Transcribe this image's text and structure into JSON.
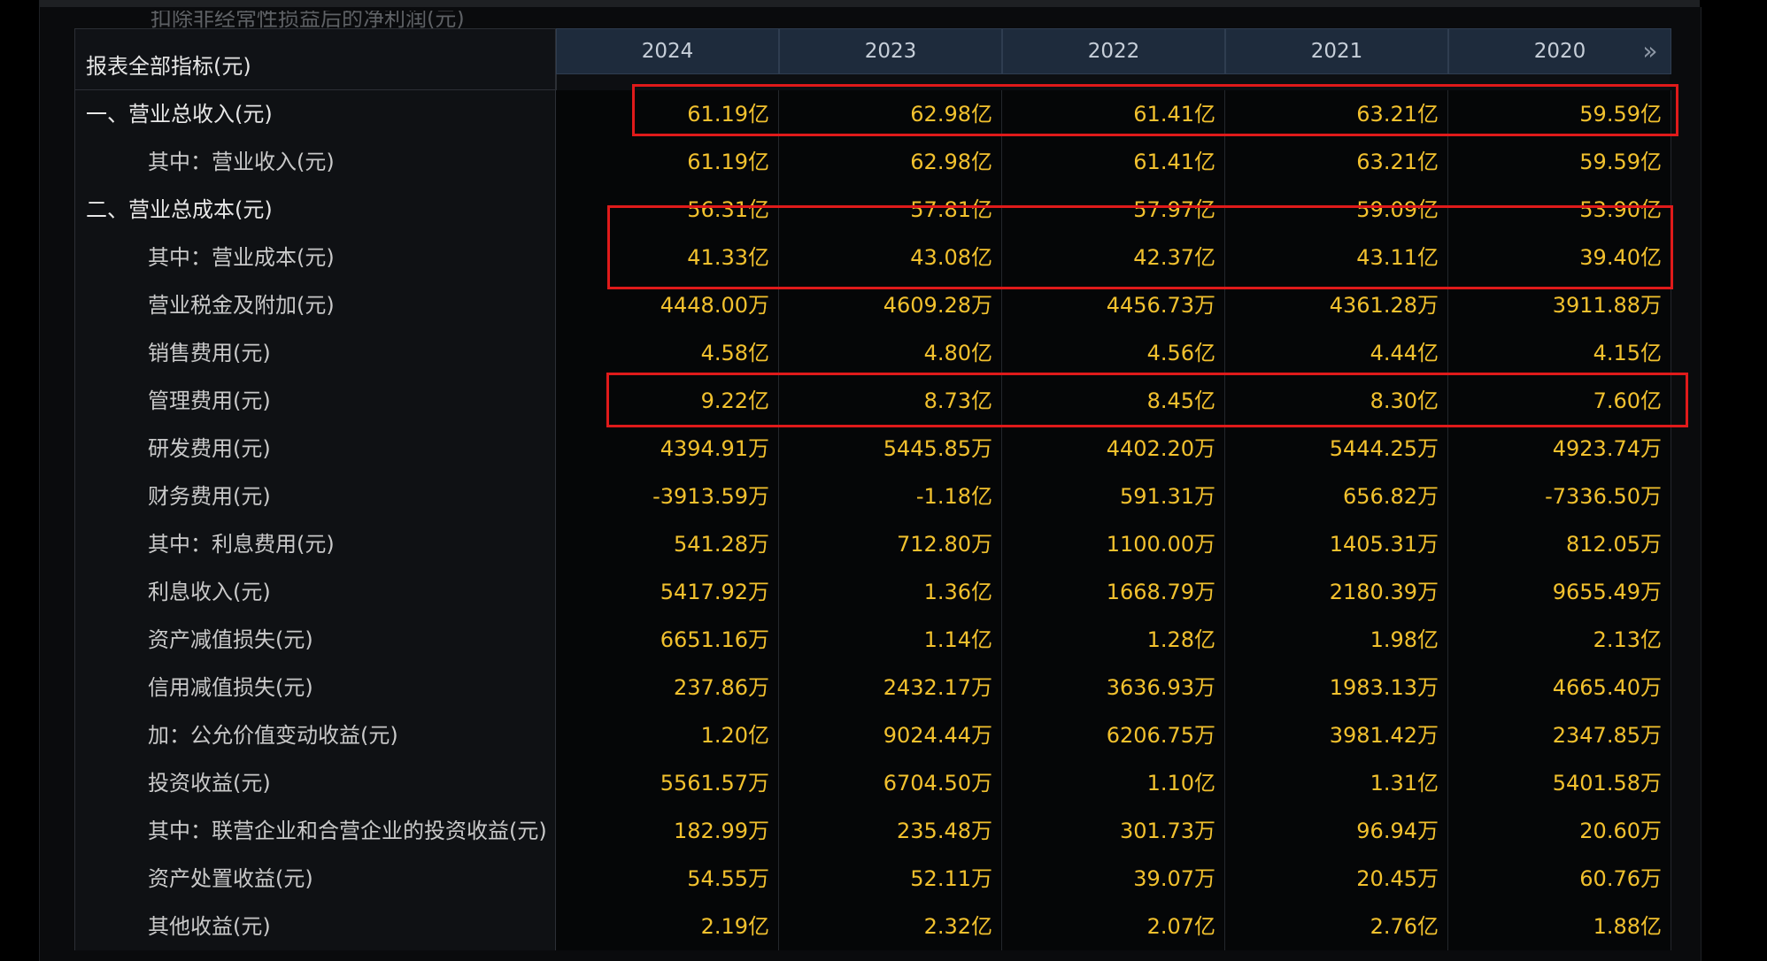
{
  "cutoff_text": "扣除非经常性损益后的净利润(元)",
  "header": {
    "metric_label": "报表全部指标(元)",
    "years": [
      "2024",
      "2023",
      "2022",
      "2021",
      "2020"
    ],
    "more_icon": "double-chevron-right-icon"
  },
  "rows": [
    {
      "label": "一、营业总收入(元)",
      "level": 0,
      "values": [
        "61.19亿",
        "62.98亿",
        "61.41亿",
        "63.21亿",
        "59.59亿"
      ]
    },
    {
      "label": "其中：营业收入(元)",
      "level": 1,
      "values": [
        "61.19亿",
        "62.98亿",
        "61.41亿",
        "63.21亿",
        "59.59亿"
      ]
    },
    {
      "label": "二、营业总成本(元)",
      "level": 0,
      "values": [
        "56.31亿",
        "57.81亿",
        "57.97亿",
        "59.09亿",
        "53.90亿"
      ]
    },
    {
      "label": "其中：营业成本(元)",
      "level": 1,
      "values": [
        "41.33亿",
        "43.08亿",
        "42.37亿",
        "43.11亿",
        "39.40亿"
      ]
    },
    {
      "label": "营业税金及附加(元)",
      "level": 1,
      "values": [
        "4448.00万",
        "4609.28万",
        "4456.73万",
        "4361.28万",
        "3911.88万"
      ]
    },
    {
      "label": "销售费用(元)",
      "level": 1,
      "values": [
        "4.58亿",
        "4.80亿",
        "4.56亿",
        "4.44亿",
        "4.15亿"
      ]
    },
    {
      "label": "管理费用(元)",
      "level": 1,
      "values": [
        "9.22亿",
        "8.73亿",
        "8.45亿",
        "8.30亿",
        "7.60亿"
      ]
    },
    {
      "label": "研发费用(元)",
      "level": 1,
      "values": [
        "4394.91万",
        "5445.85万",
        "4402.20万",
        "5444.25万",
        "4923.74万"
      ]
    },
    {
      "label": "财务费用(元)",
      "level": 1,
      "values": [
        "-3913.59万",
        "-1.18亿",
        "591.31万",
        "656.82万",
        "-7336.50万"
      ]
    },
    {
      "label": "其中：利息费用(元)",
      "level": 1,
      "values": [
        "541.28万",
        "712.80万",
        "1100.00万",
        "1405.31万",
        "812.05万"
      ]
    },
    {
      "label": "利息收入(元)",
      "level": 1,
      "values": [
        "5417.92万",
        "1.36亿",
        "1668.79万",
        "2180.39万",
        "9655.49万"
      ]
    },
    {
      "label": "资产减值损失(元)",
      "level": 1,
      "values": [
        "6651.16万",
        "1.14亿",
        "1.28亿",
        "1.98亿",
        "2.13亿"
      ]
    },
    {
      "label": "信用减值损失(元)",
      "level": 1,
      "values": [
        "237.86万",
        "2432.17万",
        "3636.93万",
        "1983.13万",
        "4665.40万"
      ]
    },
    {
      "label": "加：公允价值变动收益(元)",
      "level": 1,
      "values": [
        "1.20亿",
        "9024.44万",
        "6206.75万",
        "3981.42万",
        "2347.85万"
      ]
    },
    {
      "label": "投资收益(元)",
      "level": 1,
      "values": [
        "5561.57万",
        "6704.50万",
        "1.10亿",
        "1.31亿",
        "5401.58万"
      ]
    },
    {
      "label": "其中：联营企业和合营企业的投资收益(元)",
      "level": 1,
      "values": [
        "182.99万",
        "235.48万",
        "301.73万",
        "96.94万",
        "20.60万"
      ]
    },
    {
      "label": "资产处置收益(元)",
      "level": 1,
      "values": [
        "54.55万",
        "52.11万",
        "39.07万",
        "20.45万",
        "60.76万"
      ]
    },
    {
      "label": "其他收益(元)",
      "level": 1,
      "values": [
        "2.19亿",
        "2.32亿",
        "2.07亿",
        "2.76亿",
        "1.88亿"
      ]
    }
  ],
  "colors": {
    "value_text": "#f2c12e",
    "highlight_box": "#e01a1a",
    "header_bg": "#1e2b3c"
  }
}
